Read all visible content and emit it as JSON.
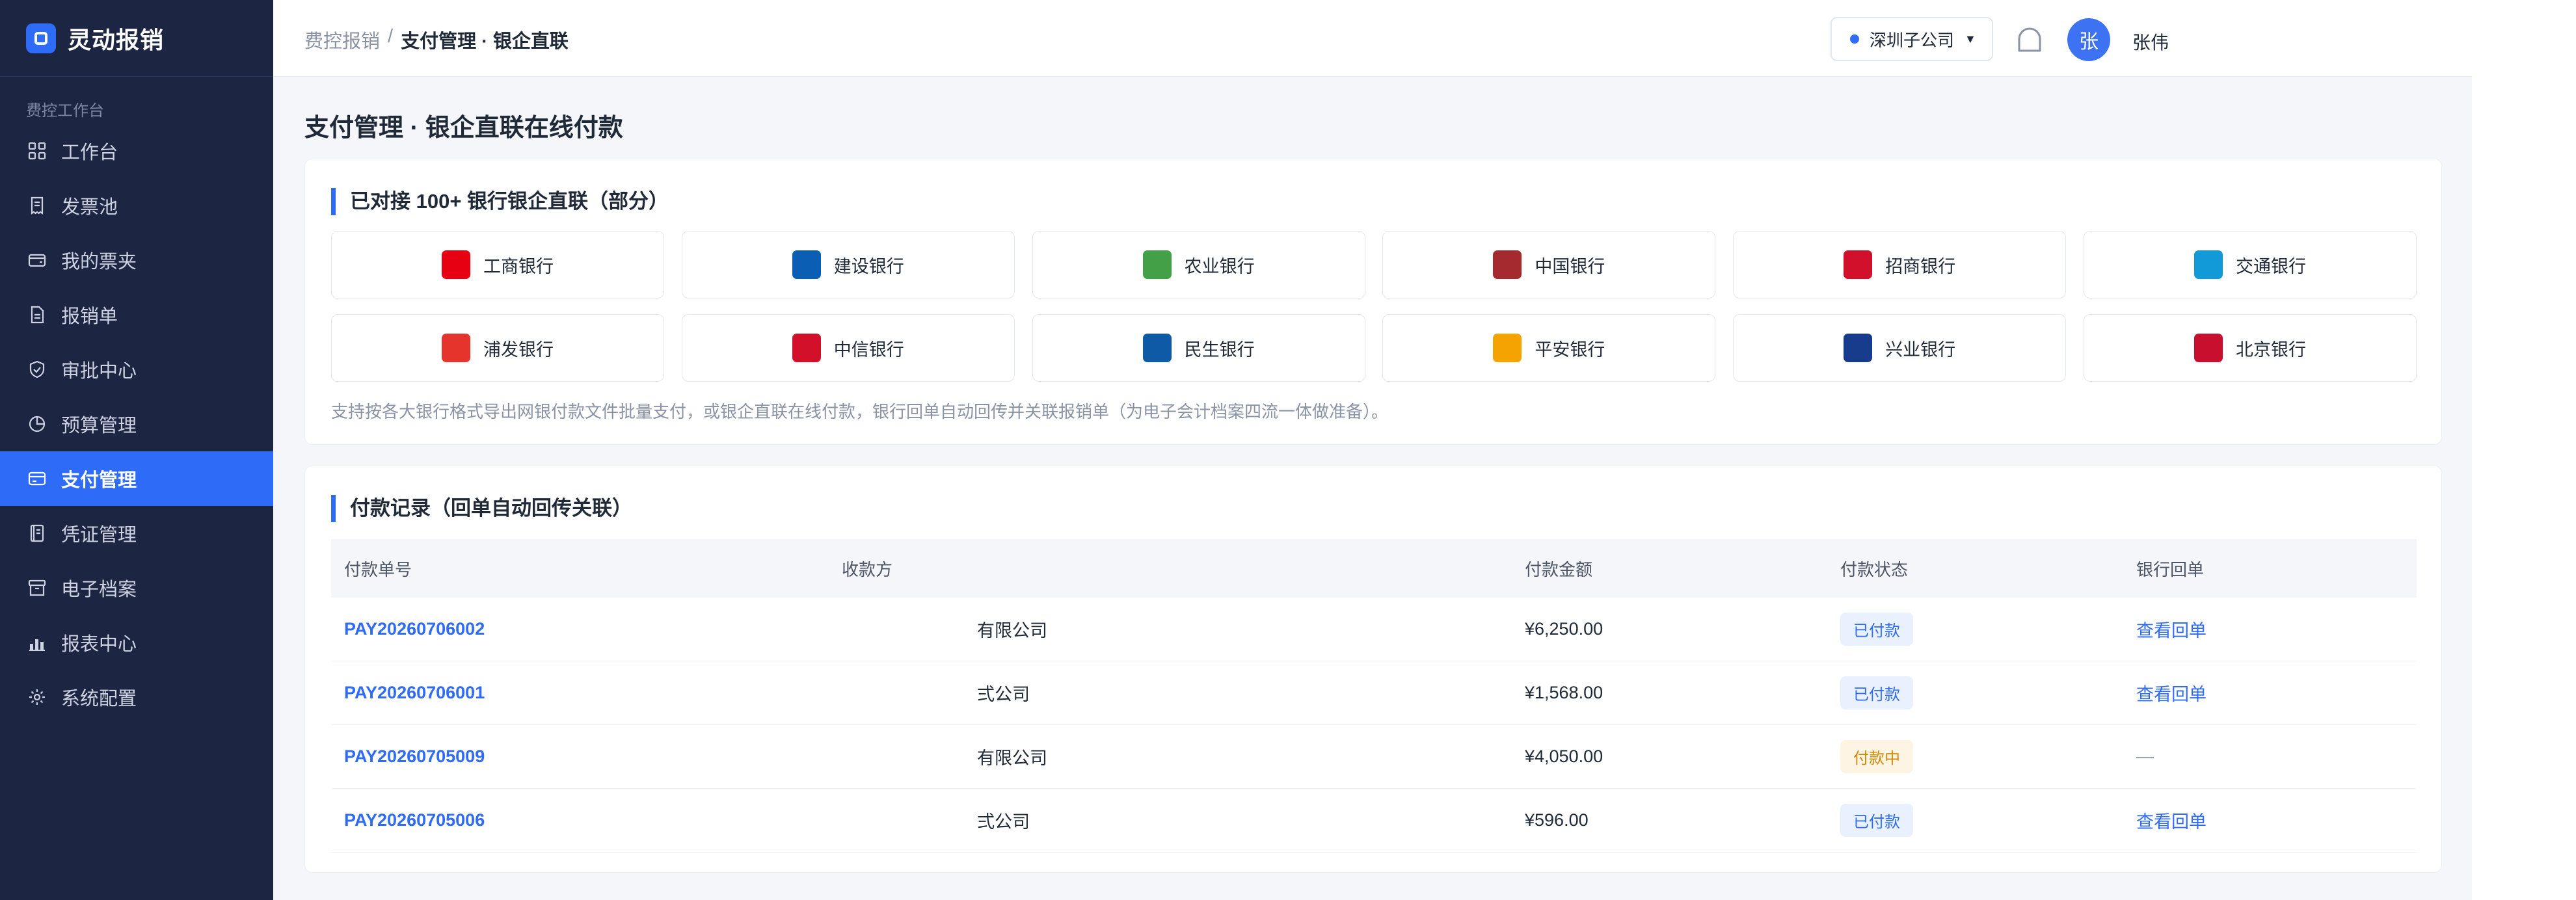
{
  "app": {
    "name": "灵动报销"
  },
  "sidebar": {
    "section_label": "费控工作台",
    "items": [
      {
        "label": "工作台",
        "icon": "grid-icon",
        "active": false
      },
      {
        "label": "发票池",
        "icon": "receipt-icon",
        "active": false
      },
      {
        "label": "我的票夹",
        "icon": "wallet-icon",
        "active": false
      },
      {
        "label": "报销单",
        "icon": "document-icon",
        "active": false
      },
      {
        "label": "审批中心",
        "icon": "shield-check-icon",
        "active": false
      },
      {
        "label": "预算管理",
        "icon": "pie-chart-icon",
        "active": false
      },
      {
        "label": "支付管理",
        "icon": "credit-card-icon",
        "active": true
      },
      {
        "label": "凭证管理",
        "icon": "book-icon",
        "active": false
      },
      {
        "label": "电子档案",
        "icon": "archive-icon",
        "active": false
      },
      {
        "label": "报表中心",
        "icon": "bar-chart-icon",
        "active": false
      },
      {
        "label": "系统配置",
        "icon": "gear-icon",
        "active": false
      }
    ]
  },
  "header": {
    "breadcrumb_parent": "费控报销",
    "breadcrumb_sep": "/",
    "breadcrumb_current": "支付管理 · 银企直联",
    "company": "深圳子公司",
    "avatar_initial": "张",
    "username": "张伟"
  },
  "page": {
    "title": "支付管理 · 银企直联在线付款"
  },
  "banks_card": {
    "title": "已对接 100+ 银行银企直联（部分）",
    "banks": [
      {
        "name": "工商银行",
        "color": "#e60012"
      },
      {
        "name": "建设银行",
        "color": "#0a5fb4"
      },
      {
        "name": "农业银行",
        "color": "#43a046"
      },
      {
        "name": "中国银行",
        "color": "#a52a2f"
      },
      {
        "name": "招商银行",
        "color": "#d1102c"
      },
      {
        "name": "交通银行",
        "color": "#129ad8"
      },
      {
        "name": "浦发银行",
        "color": "#e5342b"
      },
      {
        "name": "中信银行",
        "color": "#d3102a"
      },
      {
        "name": "民生银行",
        "color": "#0e5aa7"
      },
      {
        "name": "平安银行",
        "color": "#f5a300"
      },
      {
        "name": "兴业银行",
        "color": "#183c8c"
      },
      {
        "name": "北京银行",
        "color": "#c8102e"
      }
    ],
    "note": "支持按各大银行格式导出网银付款文件批量支付，或银企直联在线付款，银行回单自动回传并关联报销单（为电子会计档案四流一体做准备）。"
  },
  "records_card": {
    "title": "付款记录（回单自动回传关联）",
    "columns": [
      "付款单号",
      "收款方",
      "付款金额",
      "付款状态",
      "银行回单"
    ],
    "rows": [
      {
        "id": "PAY20260706002",
        "payee": "有限公司",
        "amount": "¥6,250.00",
        "status": "已付款",
        "status_type": "paid",
        "receipt": "查看回单"
      },
      {
        "id": "PAY20260706001",
        "payee": "弍公司",
        "amount": "¥1,568.00",
        "status": "已付款",
        "status_type": "paid",
        "receipt": "查看回单"
      },
      {
        "id": "PAY20260705009",
        "payee": "有限公司",
        "amount": "¥4,050.00",
        "status": "付款中",
        "status_type": "paying",
        "receipt": "—"
      },
      {
        "id": "PAY20260705006",
        "payee": "弍公司",
        "amount": "¥596.00",
        "status": "已付款",
        "status_type": "paid",
        "receipt": "查看回单"
      }
    ]
  },
  "colors": {
    "accent": "#2e6bf6",
    "sidebar_bg": "#1c2541",
    "content_bg": "#f4f6fa"
  }
}
